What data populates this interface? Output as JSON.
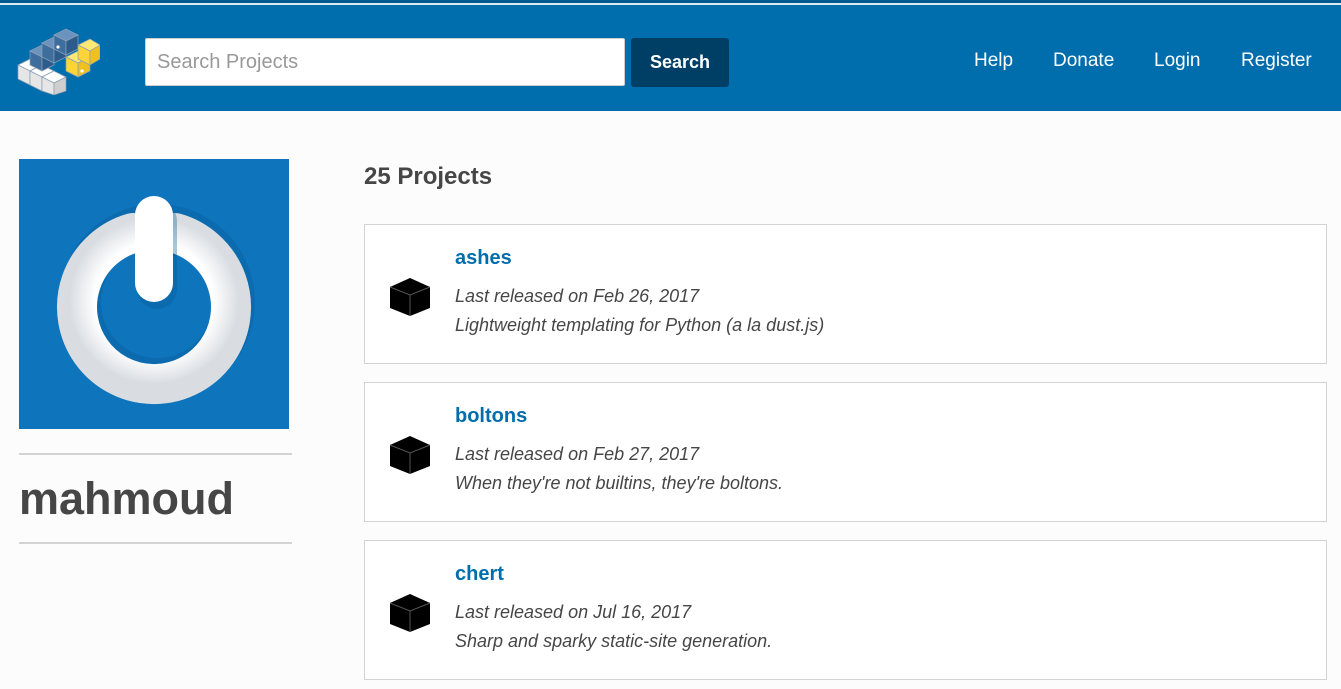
{
  "header": {
    "search_placeholder": "Search Projects",
    "search_button": "Search",
    "nav": [
      "Help",
      "Donate",
      "Login",
      "Register"
    ]
  },
  "profile": {
    "username": "mahmoud"
  },
  "projects": {
    "count_label": "25 Projects",
    "items": [
      {
        "name": "ashes",
        "released": "Last released on Feb 26, 2017",
        "description": "Lightweight templating for Python (a la dust.js)"
      },
      {
        "name": "boltons",
        "released": "Last released on Feb 27, 2017",
        "description": "When they're not builtins, they're boltons."
      },
      {
        "name": "chert",
        "released": "Last released on Jul 16, 2017",
        "description": "Sharp and sparky static-site generation."
      }
    ]
  },
  "colors": {
    "header_bg": "#006dad",
    "search_button_bg": "#003f65",
    "link": "#006dad",
    "avatar_bg": "#0e74bc"
  },
  "icons": {
    "logo": "pypi-logo-icon",
    "package": "package-cube-icon",
    "avatar": "power-symbol-icon"
  }
}
